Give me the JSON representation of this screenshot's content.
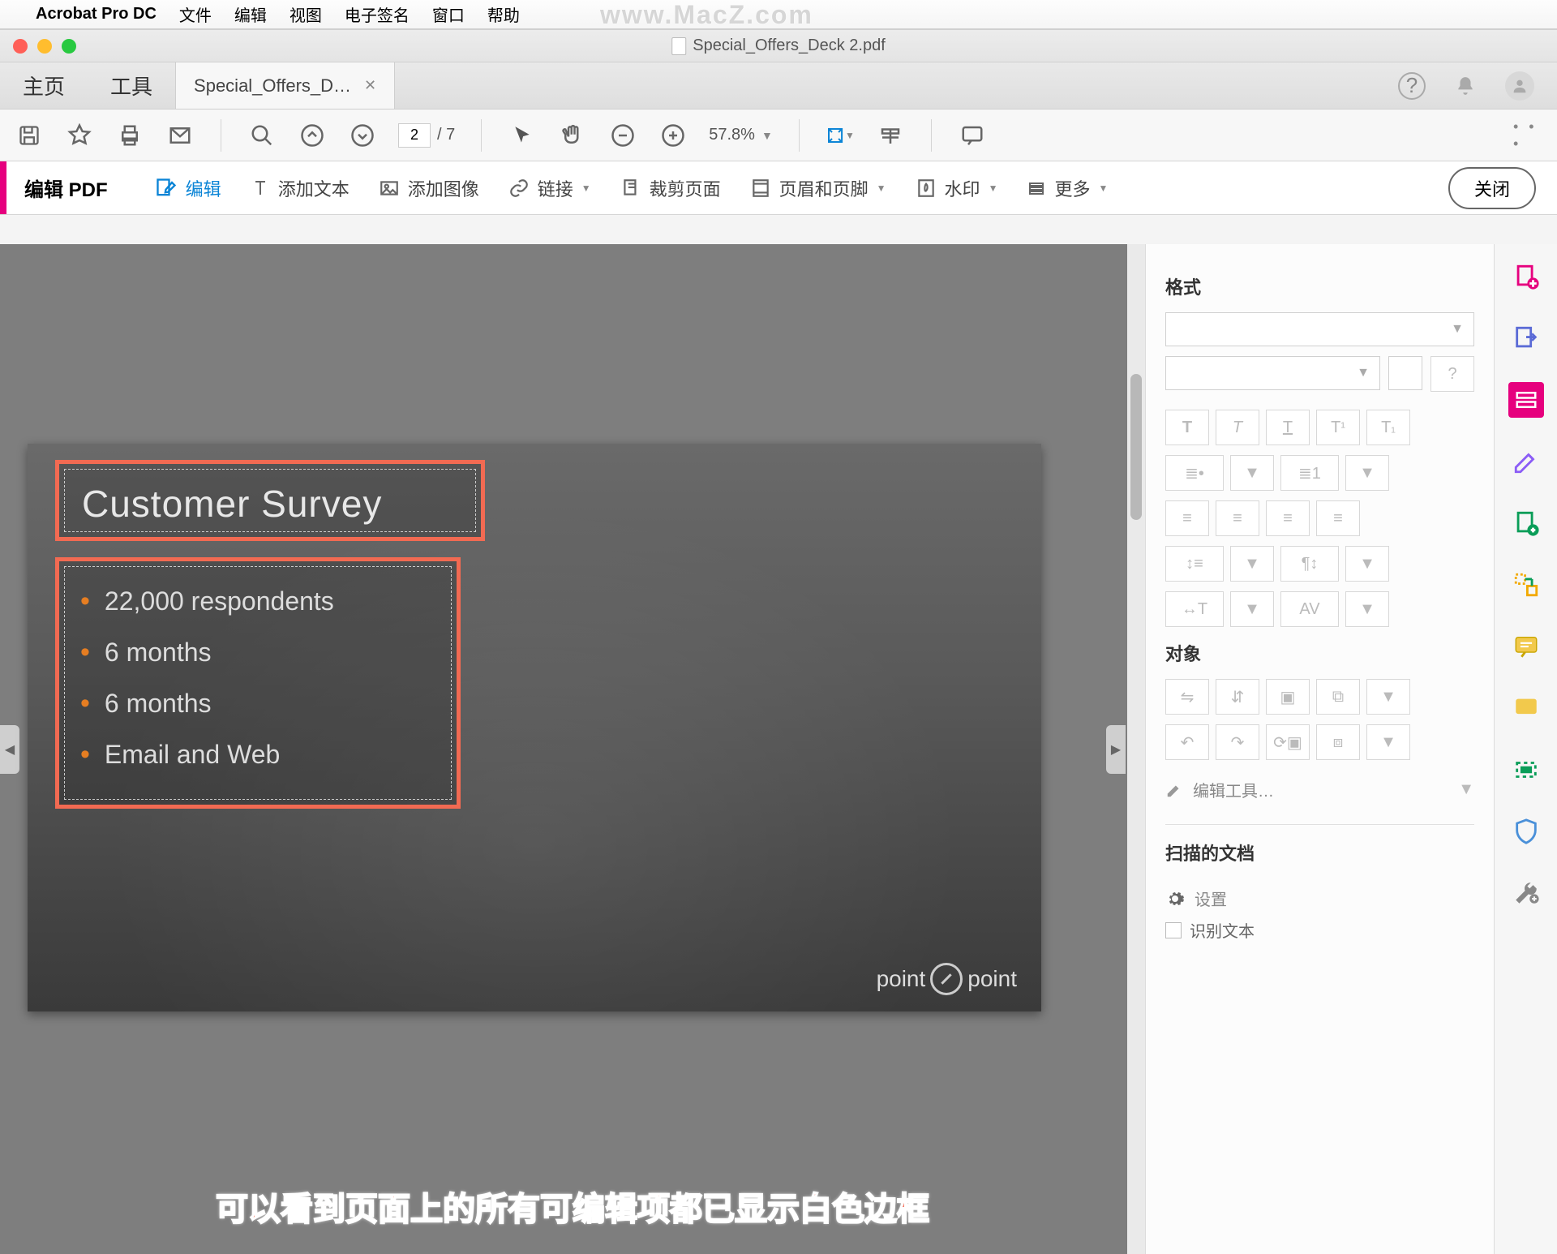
{
  "menubar": {
    "app": "Acrobat Pro DC",
    "items": [
      "文件",
      "编辑",
      "视图",
      "电子签名",
      "窗口",
      "帮助"
    ]
  },
  "watermark": "www.MacZ.com",
  "window": {
    "title": "Special_Offers_Deck 2.pdf"
  },
  "tabs": {
    "home": "主页",
    "tools": "工具",
    "doc": "Special_Offers_D…"
  },
  "toolbar": {
    "page_current": "2",
    "page_total": "/ 7",
    "zoom": "57.8%"
  },
  "editbar": {
    "title": "编辑 PDF",
    "edit": "编辑",
    "add_text": "添加文本",
    "add_image": "添加图像",
    "link": "链接",
    "crop": "裁剪页面",
    "header_footer": "页眉和页脚",
    "watermark": "水印",
    "more": "更多",
    "close": "关闭"
  },
  "page_content": {
    "title": "Customer Survey",
    "bullets": [
      "22,000 respondents",
      "6 months",
      "6 months",
      "Email and Web"
    ],
    "brand_left": "point",
    "brand_right": "point"
  },
  "annotation": "可以看到页面上的所有可编辑项都已显示白色边框",
  "format_panel": {
    "format": "格式",
    "object": "对象",
    "edit_tools": "编辑工具…",
    "scanned": "扫描的文档",
    "settings": "设置",
    "recognize": "识别文本"
  },
  "icons": {
    "help": "?",
    "bell": "🔔",
    "save": "💾",
    "star": "☆",
    "print": "🖶",
    "mail": "✉",
    "search": "⍉",
    "up": "↑",
    "down": "↓",
    "cursor": "➤",
    "hand": "✋",
    "minus": "−",
    "plus": "+",
    "fit": "⤢",
    "ruler": "⊞",
    "comment": "💬",
    "dots": "• • •"
  }
}
